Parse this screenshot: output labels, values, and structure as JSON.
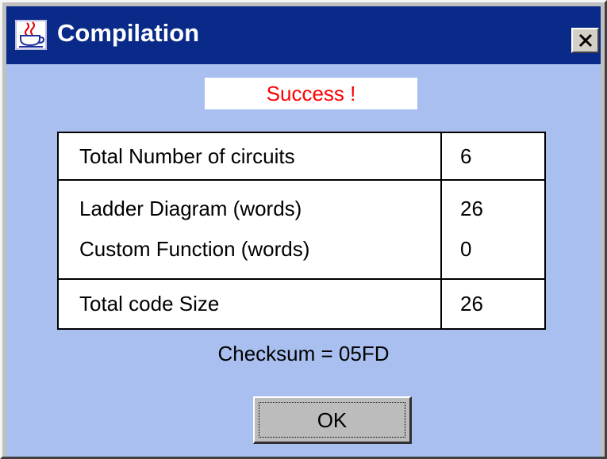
{
  "window": {
    "title": "Compilation",
    "icon": "java-cup-icon",
    "close_label": "close-icon"
  },
  "status": {
    "text": "Success !",
    "color": "#ff0000"
  },
  "table": {
    "rows": [
      {
        "label": "Total Number of circuits",
        "value": "6"
      },
      {
        "label": "Ladder Diagram (words)",
        "value": "26"
      },
      {
        "label": "Custom Function (words)",
        "value": "0"
      },
      {
        "label": "Total code Size",
        "value": "26"
      }
    ]
  },
  "checksum": "Checksum = 05FD",
  "buttons": {
    "ok_label": "OK"
  },
  "colors": {
    "titlebar": "#0a2a8a",
    "content_background": "#a9bff0"
  }
}
